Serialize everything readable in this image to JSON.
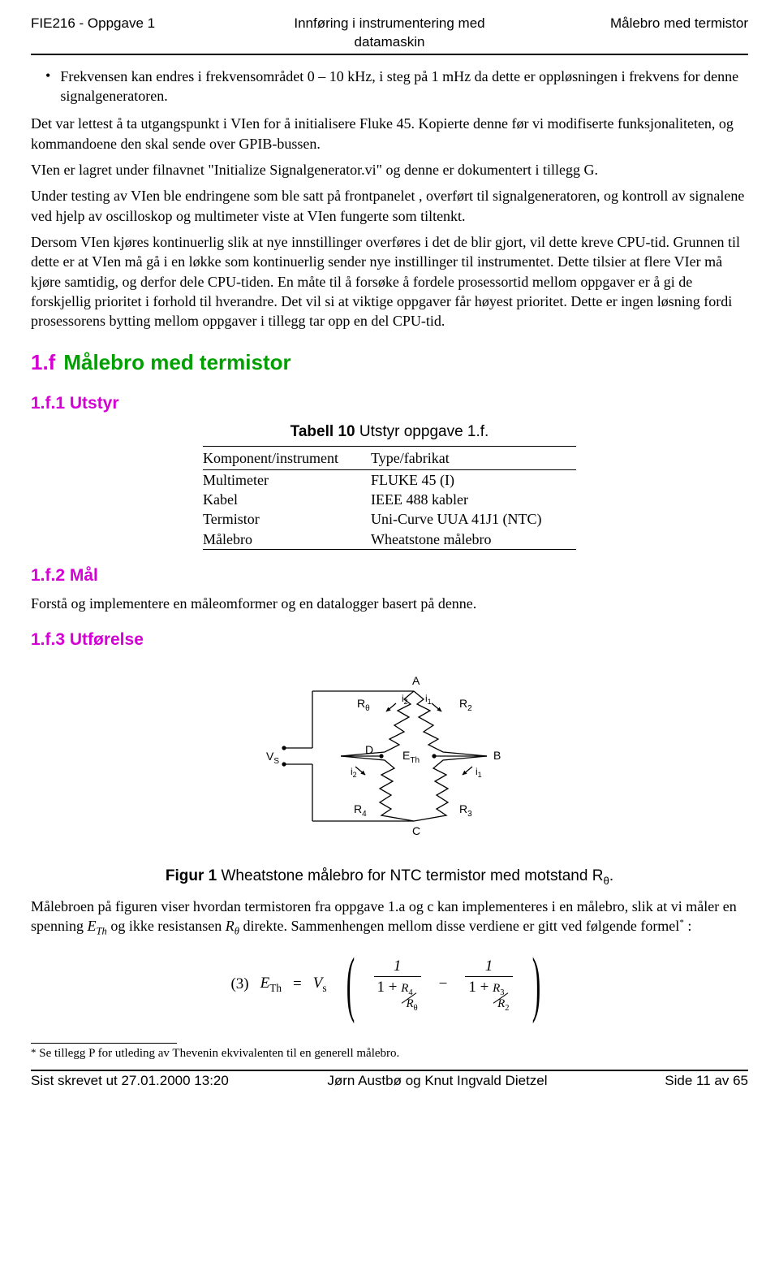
{
  "header": {
    "left": "FIE216 - Oppgave 1",
    "center": "Innføring i instrumentering med datamaskin",
    "right": "Målebro med termistor"
  },
  "body": {
    "bullet1": "Frekvensen kan endres i frekvensområdet 0 – 10 kHz, i steg på 1 mHz da dette er oppløsningen i frekvens for denne signalgeneratoren.",
    "p1": "Det var lettest å ta utgangspunkt i VIen for å initialisere Fluke 45. Kopierte denne før vi modifiserte funksjonaliteten, og kommandoene den skal sende over GPIB-bussen.",
    "p2": "VIen er lagret under filnavnet \"Initialize Signalgenerator.vi\" og denne er dokumentert i tillegg G.",
    "p3": "Under testing av VIen ble endringene som ble satt på frontpanelet , overført til signalgeneratoren, og kontroll av signalene ved hjelp av oscilloskop og multimeter viste at VIen fungerte som tiltenkt.",
    "p4": "Dersom VIen kjøres kontinuerlig slik at nye innstillinger overføres i det de blir gjort, vil dette kreve CPU-tid. Grunnen til dette er at VIen må gå i en løkke som kontinuerlig sender nye instillinger til instrumentet. Dette tilsier at flere VIer må kjøre samtidig, og derfor dele CPU-tiden. En måte til å forsøke å fordele prosessortid mellom oppgaver er å gi de forskjellig prioritet i forhold til hverandre. Det vil si at viktige oppgaver får høyest prioritet. Dette er ingen løsning fordi prosessorens bytting mellom oppgaver i tillegg tar opp en del CPU-tid."
  },
  "section_1f": {
    "num": "1.f",
    "title": "Målebro med termistor"
  },
  "subsection_1f1": "1.f.1   Utstyr",
  "table10": {
    "caption_prefix": "Tabell 10",
    "caption_rest": " Utstyr oppgave 1.f.",
    "headers": [
      "Komponent/instrument",
      "Type/fabrikat"
    ],
    "rows": [
      [
        "Multimeter",
        "FLUKE 45 (I)"
      ],
      [
        "Kabel",
        "IEEE 488 kabler"
      ],
      [
        "Termistor",
        "Uni-Curve UUA 41J1 (NTC)"
      ],
      [
        "Målebro",
        "Wheatstone målebro"
      ]
    ]
  },
  "subsection_1f2": "1.f.2   Mål",
  "p5": "Forstå og implementere en måleomformer og en datalogger basert på denne.",
  "subsection_1f3": "1.f.3   Utførelse",
  "figure1": {
    "caption_prefix": "Figur 1",
    "caption_rest": " Wheatstone målebro for NTC termistor med motstand R",
    "caption_sub": "θ",
    "caption_end": ".",
    "labels": {
      "A": "A",
      "B": "B",
      "C": "C",
      "D": "D",
      "Vs": "V",
      "Vs_sub": "S",
      "ETh": "E",
      "ETh_sub": "Th",
      "Rtheta": "R",
      "Rtheta_sub": "θ",
      "R2": "R",
      "R2_sub": "2",
      "R3": "R",
      "R3_sub": "3",
      "R4": "R",
      "R4_sub": "4",
      "i1": "i",
      "i1_sub": "1",
      "i2": "i",
      "i2_sub": "2"
    }
  },
  "p6_a": "Målebroen på figuren viser hvordan termistoren fra oppgave 1.a og c kan implementeres i en målebro, slik at vi måler en spenning ",
  "p6_eth": "E",
  "p6_eth_sub": "Th",
  "p6_b": " og ikke resistansen ",
  "p6_r": "R",
  "p6_r_sub": "θ",
  "p6_c": " direkte. Sammenhengen mellom disse verdiene er gitt ved følgende formel",
  "p6_star": "*",
  "p6_d": " :",
  "equation": {
    "num": "(3)",
    "lhs_E": "E",
    "lhs_E_sub": "Th",
    "eq": " = ",
    "Vs": "V",
    "Vs_sub": "s",
    "one": "1",
    "plus": "1 + ",
    "R4": "R",
    "R4_sub": "4",
    "Rt": "R",
    "Rt_sub": "θ",
    "minus": "−",
    "R3": "R",
    "R3_sub": "3",
    "R2": "R",
    "R2_sub": "2"
  },
  "footnote": {
    "star": "*",
    "text": " Se tillegg P for utleding av Thevenin ekvivalenten til en generell målebro."
  },
  "footer": {
    "left": "Sist skrevet ut 27.01.2000 13:20",
    "center": "Jørn Austbø og Knut Ingvald Dietzel",
    "right": "Side 11 av 65"
  }
}
